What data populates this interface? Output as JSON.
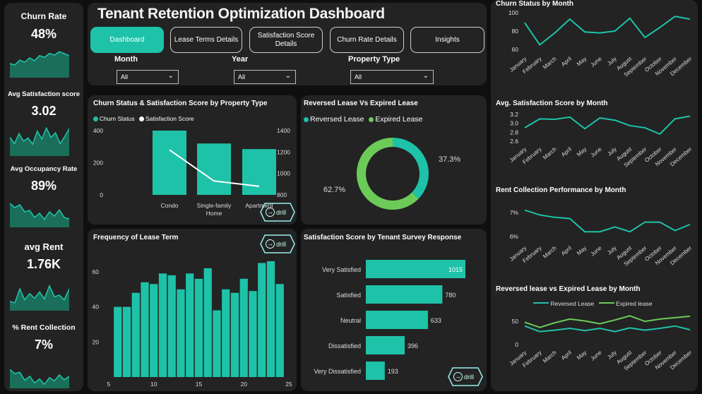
{
  "colors": {
    "teal": "#1ec2a8",
    "green": "#6ccb58",
    "panel": "#232323",
    "bg": "#0f0f0f"
  },
  "title": "Tenant Retention Optimization Dashboard",
  "tabs": [
    "Dashboard",
    "Lease Terms Details",
    "Satisfaction Score Details",
    "Churn Rate Details",
    "Insights"
  ],
  "filters": [
    {
      "label": "Month",
      "value": "All"
    },
    {
      "label": "Year",
      "value": "All"
    },
    {
      "label": "Property Type",
      "value": "All"
    }
  ],
  "kpis": [
    {
      "label": "Churn Rate",
      "value": "48%",
      "trend": [
        0.5,
        0.45,
        0.62,
        0.55,
        0.7,
        0.6,
        0.78,
        0.72,
        0.86,
        0.8,
        0.92,
        0.85,
        0.78
      ]
    },
    {
      "label": "Avg Satisfaction score",
      "value": "3.02",
      "trend": [
        0.6,
        0.4,
        0.72,
        0.48,
        0.58,
        0.38,
        0.8,
        0.55,
        0.9,
        0.6,
        0.75,
        0.4,
        0.62,
        0.88
      ]
    },
    {
      "label": "Avg Occupancy Rate",
      "value": "89%",
      "trend": [
        0.85,
        0.7,
        0.8,
        0.55,
        0.6,
        0.35,
        0.5,
        0.28,
        0.55,
        0.4,
        0.62,
        0.35,
        0.3
      ]
    },
    {
      "label": "avg Rent",
      "value": "1.76K",
      "trend": [
        0.3,
        0.25,
        0.7,
        0.35,
        0.55,
        0.4,
        0.6,
        0.38,
        0.8,
        0.45,
        0.5,
        0.35,
        0.7
      ]
    },
    {
      "label": "% Rent Collection",
      "value": "7%",
      "trend": [
        0.7,
        0.55,
        0.6,
        0.3,
        0.45,
        0.2,
        0.35,
        0.15,
        0.4,
        0.28,
        0.5,
        0.32,
        0.45
      ]
    }
  ],
  "drill_label": "drill",
  "chart_data": [
    {
      "type": "bar",
      "title": "Churn Status & Satisfaction Score by Property Type",
      "legend": [
        "Churn Status",
        "Satisfaction Score"
      ],
      "categories": [
        "Condo",
        "Single-family Home",
        "Apartment"
      ],
      "series": [
        {
          "name": "Churn Status",
          "values": [
            400,
            320,
            285
          ]
        },
        {
          "name": "Satisfaction Score",
          "values": [
            1220,
            930,
            880
          ]
        }
      ],
      "ylim": [
        0,
        400
      ],
      "y2lim": [
        800,
        1400
      ],
      "yticks": [
        "400",
        "200",
        "0"
      ],
      "y2ticks": [
        "1400",
        "1200",
        "1000",
        "800"
      ]
    },
    {
      "type": "pie",
      "title": "Reversed Lease Vs Expired Lease",
      "legend": [
        "Reversed Lease",
        "Expired Lease"
      ],
      "values": [
        37.3,
        62.7
      ],
      "labels": [
        "37.3%",
        "62.7%"
      ]
    },
    {
      "type": "bar",
      "title": "Frequency of Lease Term",
      "x": [
        6,
        7,
        8,
        9,
        10,
        11,
        12,
        13,
        14,
        15,
        16,
        17,
        18,
        19,
        20,
        21,
        22,
        23,
        24
      ],
      "values": [
        40,
        40,
        48,
        54,
        53,
        59,
        58,
        50,
        59,
        56,
        62,
        38,
        50,
        48,
        56,
        49,
        65,
        66,
        53
      ],
      "ylim": [
        0,
        70
      ],
      "yticks": [
        "60",
        "40",
        "20"
      ],
      "xticks": [
        "5",
        "10",
        "15",
        "20",
        "25"
      ]
    },
    {
      "type": "bar",
      "title": "Satisfaction Score by Tenant Survey Response",
      "categories": [
        "Very Satisfied",
        "Satisfied",
        "Neutral",
        "Dissatisfied",
        "Very Dissatisfied"
      ],
      "values": [
        1015,
        780,
        633,
        396,
        193
      ],
      "labels": [
        "1015",
        "780",
        "633",
        "396",
        "193"
      ]
    },
    {
      "type": "line",
      "title": "Churn Status by Month",
      "categories": [
        "January",
        "February",
        "March",
        "April",
        "May",
        "June",
        "July",
        "August",
        "September",
        "October",
        "November",
        "December"
      ],
      "values": [
        89,
        65,
        78,
        93,
        79,
        78,
        80,
        94,
        73,
        84,
        96,
        93
      ],
      "yticks": [
        "100",
        "80",
        "60"
      ],
      "ylim": [
        60,
        100
      ]
    },
    {
      "type": "line",
      "title": "Avg. Satisfaction Score by Month",
      "categories": [
        "January",
        "February",
        "March",
        "April",
        "May",
        "June",
        "July",
        "August",
        "September",
        "October",
        "November",
        "December"
      ],
      "values": [
        2.9,
        3.1,
        3.09,
        3.14,
        2.88,
        3.12,
        3.07,
        2.95,
        2.9,
        2.76,
        3.1,
        3.16
      ],
      "yticks": [
        "3.2",
        "3.0",
        "2.8",
        "2.6"
      ],
      "ylim": [
        2.6,
        3.2
      ]
    },
    {
      "type": "line",
      "title": "Rent Collection Performance by Month",
      "categories": [
        "January",
        "February",
        "March",
        "April",
        "May",
        "June",
        "July",
        "August",
        "September",
        "October",
        "November",
        "December"
      ],
      "values": [
        7.1,
        6.9,
        6.8,
        6.75,
        6.2,
        6.2,
        6.4,
        6.2,
        6.6,
        6.6,
        6.25,
        6.5
      ],
      "yticks": [
        "7%",
        "6%"
      ],
      "ylim": [
        5.5,
        7.5
      ]
    },
    {
      "type": "line",
      "title": "Reversed lease vs Expired Lease by Month",
      "legend": [
        "Reversed Lease",
        "Expired lease"
      ],
      "categories": [
        "January",
        "February",
        "March",
        "April",
        "May",
        "June",
        "July",
        "August",
        "September",
        "October",
        "November",
        "December"
      ],
      "series": [
        {
          "name": "Reversed Lease",
          "values": [
            40,
            28,
            31,
            35,
            30,
            35,
            28,
            36,
            31,
            35,
            40,
            32
          ]
        },
        {
          "name": "Expired lease",
          "values": [
            48,
            37,
            47,
            55,
            51,
            45,
            53,
            62,
            50,
            55,
            58,
            61
          ]
        }
      ],
      "yticks": [
        "50",
        "0"
      ],
      "ylim": [
        0,
        70
      ]
    }
  ]
}
